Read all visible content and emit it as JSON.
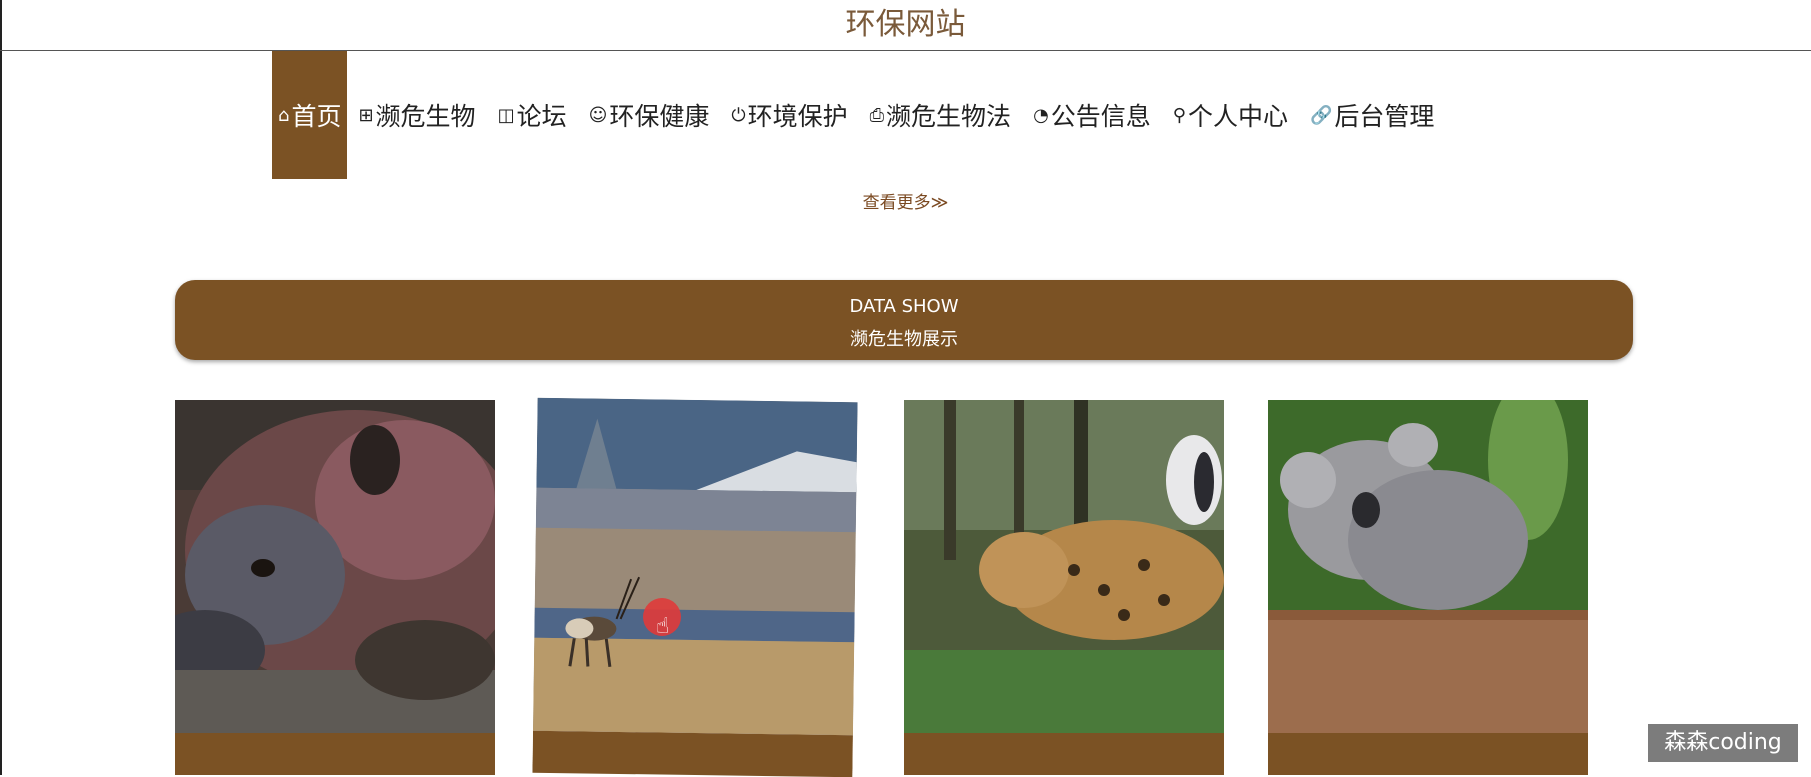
{
  "site": {
    "title": "环保网站"
  },
  "nav": {
    "items": [
      {
        "icon": "⌂",
        "label": "首页",
        "active": true
      },
      {
        "icon": "⊞",
        "label": "濒危生物"
      },
      {
        "icon": "◫",
        "label": "论坛"
      },
      {
        "icon": "☺",
        "label": "环保健康"
      },
      {
        "icon": "⏻",
        "label": "环境保护"
      },
      {
        "icon": "⎙",
        "label": "濒危生物法"
      },
      {
        "icon": "◔",
        "label": "公告信息"
      },
      {
        "icon": "⚲",
        "label": "个人中心"
      },
      {
        "icon": "🔗",
        "label": "后台管理"
      }
    ]
  },
  "more": {
    "label": "查看更多≫"
  },
  "banner": {
    "en": "DATA SHOW",
    "cn": "濒危生物展示"
  },
  "cards": [
    {
      "icon": "rhino-photo"
    },
    {
      "icon": "antelope-photo"
    },
    {
      "icon": "leopard-photo"
    },
    {
      "icon": "koala-photo"
    }
  ],
  "watermark": {
    "text": "森森coding"
  },
  "colors": {
    "accent": "#7b5224",
    "title": "#7a5a3a"
  }
}
